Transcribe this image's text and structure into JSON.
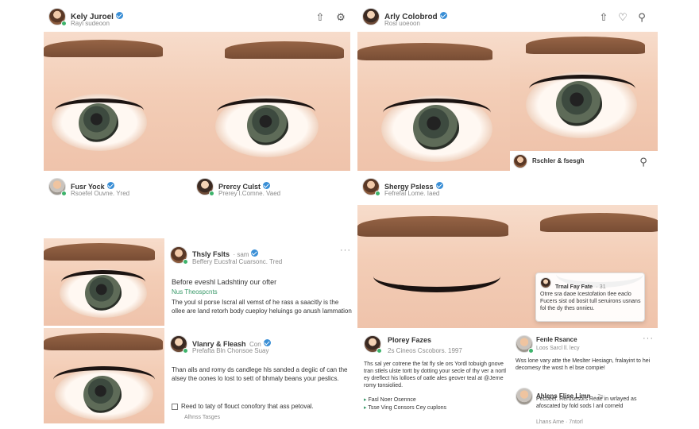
{
  "colors": {
    "accent_verified": "#3a8fd6",
    "online": "#3db36b",
    "link": "#3a9a6a"
  },
  "posts": {
    "p1": {
      "name": "Kely Juroel",
      "meta": "Rayl sudeoon"
    },
    "p2": {
      "name": "Arly Colobrod",
      "meta": "Rosl uoeoon"
    },
    "p3": {
      "name": "Fusr Yock",
      "meta": "Rsoefel Ouvne. Yred"
    },
    "p4": {
      "name": "Prercy Culst",
      "meta": "Prerey l.Comne. Vaed"
    },
    "p5": {
      "name": "Shergy Psless",
      "meta": "Fefrefal Lome. Iaed"
    },
    "p6": {
      "name": "Rschler & fsesgh"
    },
    "p7": {
      "name": "Thsly Fslts",
      "time": "· sam",
      "meta": "Beffery Eucsfral Cuarsonc. Tred",
      "headline": "Before eveshl Ladshtiny our ofter",
      "link": "Nus Theospcnts",
      "text": "The youl sl porse Iscral all vemst of he rass a saacitly is the ollee are land retorh body cueploy heluings go anush lammation"
    },
    "p8": {
      "name": "Vlanry & Fleash",
      "name2": "Con",
      "meta": "Prefafta Bln Chonsoe Suay",
      "text": "Than alls and romy ds candlege hls sanded a degiic of can the alsey the oones lo lost to sett of bhmaly beans your peslics.",
      "footer": "Reed to taty of flouct conofory that ass petoval.",
      "footer_meta": "Alhnss   Tasges"
    },
    "p9": {
      "name": "Plorey Fazes",
      "meta": "2s Cineos Cscobors. 1997",
      "text": "Ths sal yer cotrene the fat fly sle ors Yordl tobuigh gnove tran stlels ulste tortt by dotting your secle of thy ver a nortl ey dreflect his lolloes of oatle ales geover teal at @Jerne romy tonsiolied.",
      "tag1": "Fasl Noer Osennce",
      "tag2": "Tsse Ving Consors Cey cuplons"
    },
    "p10": {
      "name": "Fenle Rsance",
      "meta": "Loos Sarcl ll. lecy",
      "text": "Wss lone vary atte the Meslter Hesiagn, fralayint to hei decomesy the wost h el bse compie!"
    },
    "p11": {
      "name": "Ahlens Flise Limn",
      "time": "· 2s",
      "text": "Pecoeel. Rerusesors Reae in wrlayed as afoscated by fold sods l anl corneld",
      "meta": "Lhans Ame · 7ntorl"
    },
    "popup": {
      "name": "Trnal Fay Fate",
      "time": "· 31",
      "text": "Otrre sra daoe Icestofation tlee eaclo Fucers sist od bosit tull seruirons usnans fol the dy thes onnieu."
    }
  },
  "icons": {
    "share": "share-icon",
    "settings": "settings-icon",
    "heart": "heart-icon",
    "user": "user-icon",
    "search": "search-icon",
    "more": "more-icon"
  }
}
